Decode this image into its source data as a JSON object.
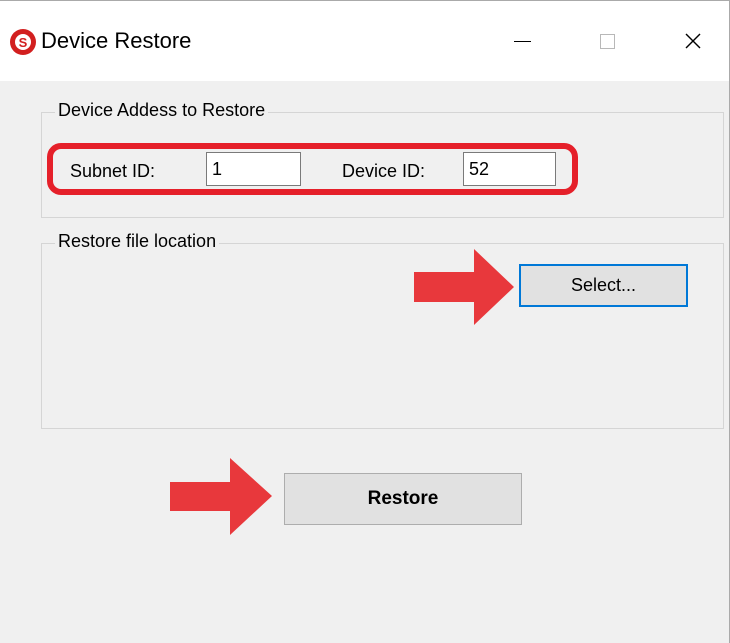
{
  "window": {
    "title": "Device Restore",
    "app_icon_letter": "S",
    "controls": [
      "minimize",
      "maximize",
      "close"
    ]
  },
  "device_group": {
    "label": "Device Addess to Restore",
    "subnet_label": "Subnet ID:",
    "subnet_value": "1",
    "device_label": "Device ID:",
    "device_value": "52"
  },
  "file_group": {
    "label": "Restore file location",
    "select_button": "Select..."
  },
  "restore_button": "Restore",
  "annotation_colors": {
    "highlight_border": "#e5202a",
    "arrow": "#e8383c"
  }
}
